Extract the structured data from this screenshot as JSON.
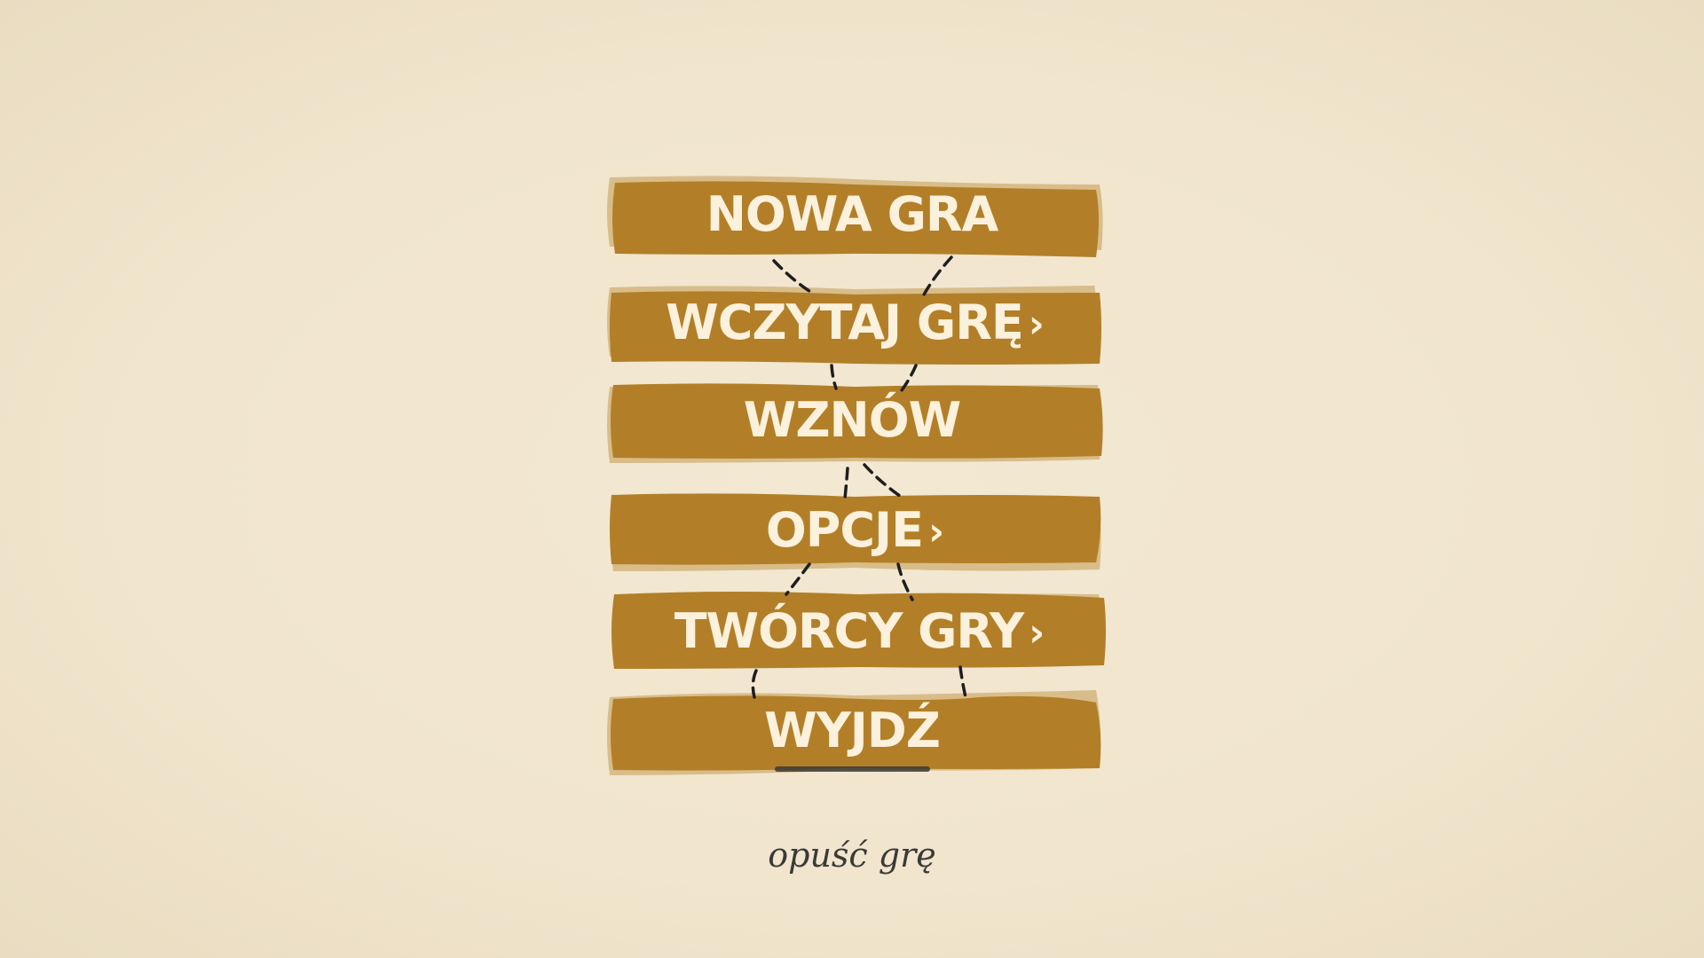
{
  "menu": {
    "items": [
      {
        "label": "NOWA GRA",
        "arrow": ""
      },
      {
        "label": "WCZYTAJ GRĘ",
        "arrow": "›"
      },
      {
        "label": "WZNÓW",
        "arrow": ""
      },
      {
        "label": "OPCJE",
        "arrow": "›"
      },
      {
        "label": "TWÓRCY GRY",
        "arrow": "›"
      },
      {
        "label": "WYJDŹ",
        "arrow": ""
      }
    ],
    "quit_label": "opuść grę"
  },
  "colors": {
    "plank": "#b27f28",
    "plank_shadow": "#d8bd8a",
    "label": "#fbf1dc",
    "background": "#f2e6cf",
    "rope": "#1e1e1e"
  }
}
